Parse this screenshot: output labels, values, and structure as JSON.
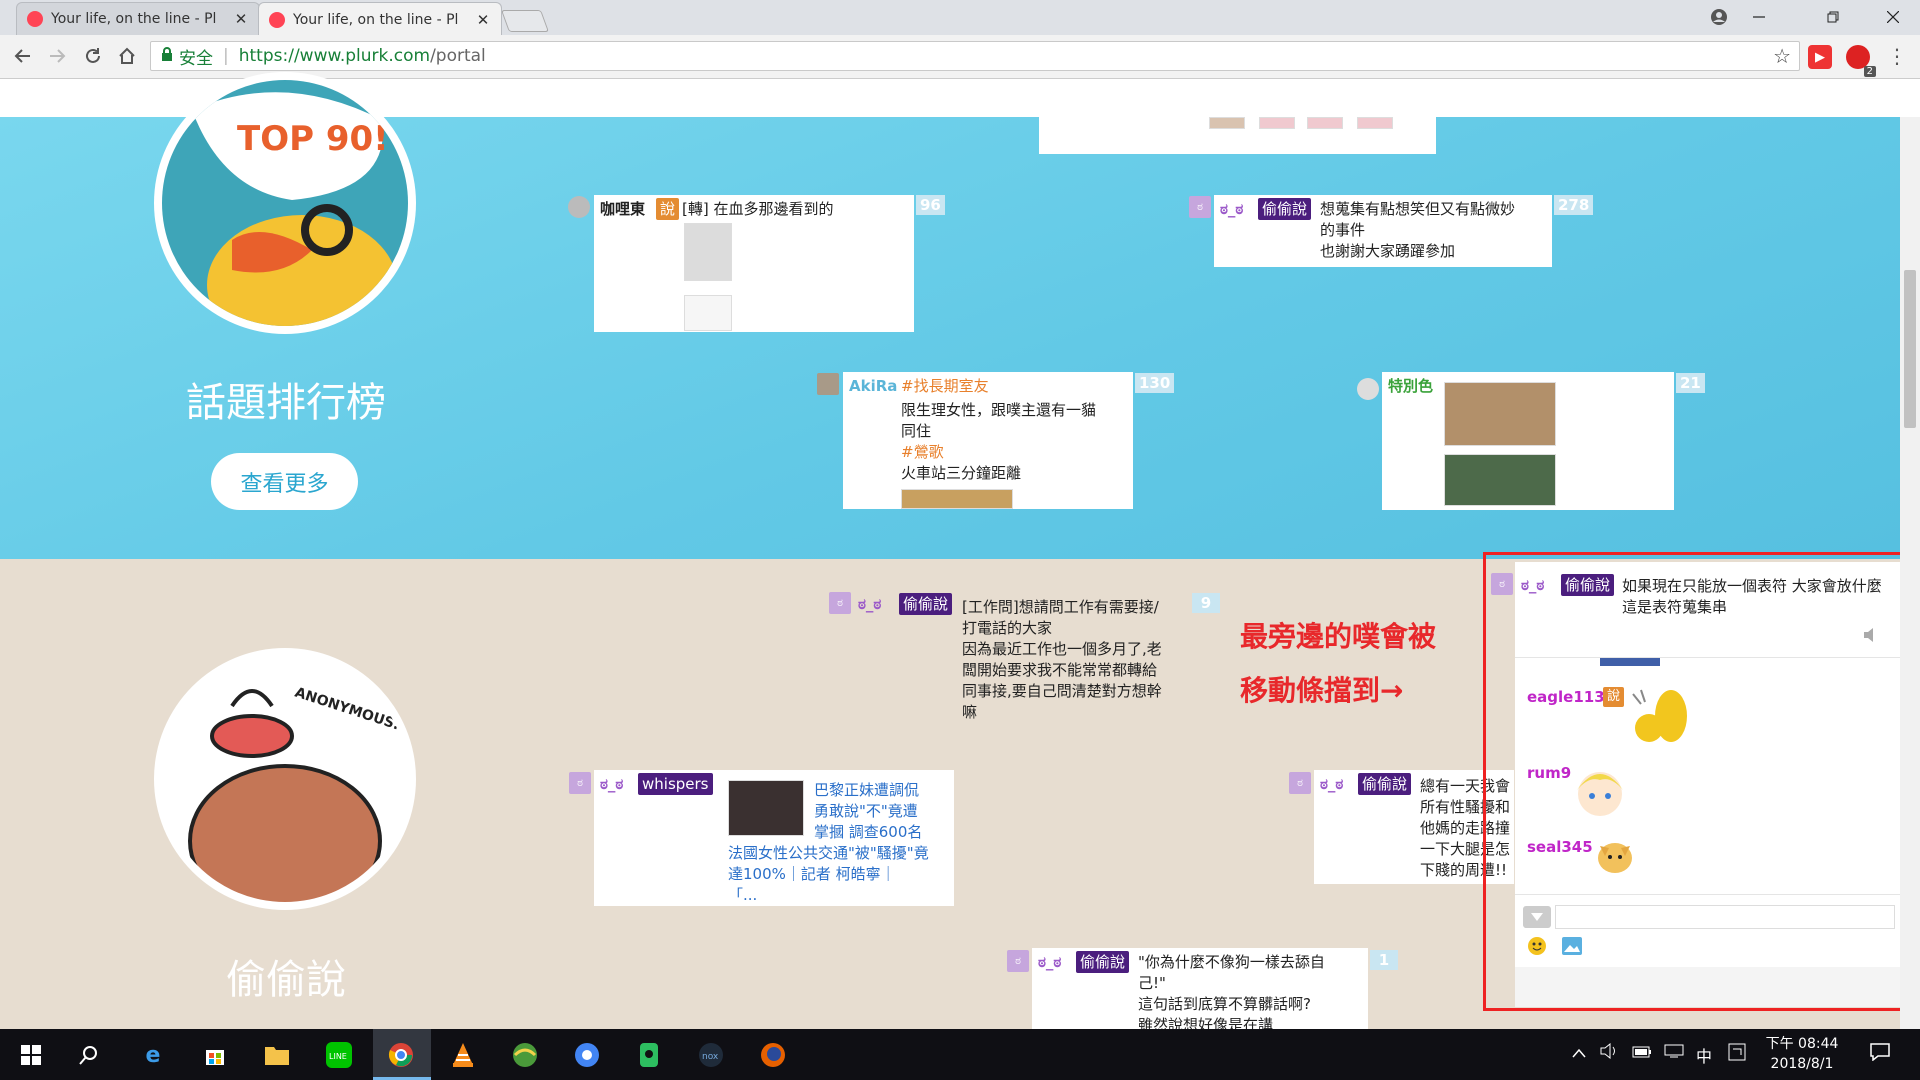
{
  "browser": {
    "tabs": [
      {
        "title": "Your life, on the line - Pl",
        "close": "✕"
      },
      {
        "title": "Your life, on the line - Pl",
        "close": "✕"
      }
    ],
    "secure_label": "安全",
    "url_host": "https://www.plurk.com",
    "url_path": "/portal",
    "ext_badge": "2"
  },
  "page": {
    "section_hot": {
      "title": "話題排行榜",
      "more_button": "查看更多",
      "badge": "TOP 90!"
    },
    "section_secret": {
      "title": "偷偷說",
      "badge": "ANONYMOUS."
    },
    "annotation": [
      "最旁邊的噗會被",
      "移動條擋到→"
    ]
  },
  "hot_plurks": [
    {
      "user": "咖哩東",
      "qualifier": "說",
      "text": "[轉] 在血多那邊看到的",
      "count": "96"
    },
    {
      "user": "ಠ_ಠ",
      "qualifier": "偷偷說",
      "text": [
        "想蒐集有點想笑但又有點微妙",
        "的事件",
        "也謝謝大家踴躍參加"
      ],
      "count": "278"
    },
    {
      "user": "AkiRa",
      "tag": "#找長期室友",
      "text": [
        "限生理女性，跟噗主還有一貓",
        "同住"
      ],
      "tag2": "#鶯歌",
      "text2": "火車站三分鐘距離",
      "count": "130"
    },
    {
      "user": "特別色",
      "count": "21"
    }
  ],
  "secret_plurks": [
    {
      "user": "ಠ_ಠ",
      "qualifier": "偷偷說",
      "text": [
        "[工作問]想請問工作有需要接/",
        "打電話的大家",
        "因為最近工作也一個多月了,老",
        "闆開始要求我不能常常都轉給",
        "同事接,要自己問清楚對方想幹",
        "嘛"
      ],
      "count": "9"
    },
    {
      "user": "ಠ_ಠ",
      "qualifier": "whispers",
      "link": [
        "巴黎正妹遭調侃",
        "勇敢說\"不\"竟遭",
        "掌摑 調查600名",
        "法國女性公共交通\"被\"騷擾\"竟",
        "達100%｜記者 柯皓寧｜",
        "「..."
      ]
    },
    {
      "user": "ಠ_ಠ",
      "qualifier": "偷偷說",
      "text": [
        "總有一天我會",
        "所有性騷擾和",
        "他媽的走路撞",
        "一下大腿是怎",
        "下賤的周遭!!"
      ]
    },
    {
      "user": "ಠ_ಠ",
      "qualifier": "偷偷說",
      "text": [
        "\"你為什麼不像狗一樣去舔自",
        "己!\"",
        "這句話到底算不算髒話啊?",
        "雖然說想好像是在講"
      ],
      "count": "1"
    }
  ],
  "expanded_plurk": {
    "user": "ಠ_ಠ",
    "qualifier": "偷偷說",
    "text": [
      "如果現在只能放一個表符 大家會放什麼",
      "這是表符蒐集串"
    ],
    "responses": [
      {
        "user": "eagle113",
        "qualifier": "說"
      },
      {
        "user": "rum9"
      },
      {
        "user": "seal345"
      }
    ],
    "reply_placeholder": ""
  },
  "taskbar": {
    "time": "下午 08:44",
    "date": "2018/8/1",
    "ime": "中"
  },
  "colors": {
    "accent_blue": "#62c9e6",
    "beige": "#e7ddd0",
    "plurk_purple": "#4b1e7e",
    "annotation_red": "#e8282b"
  }
}
